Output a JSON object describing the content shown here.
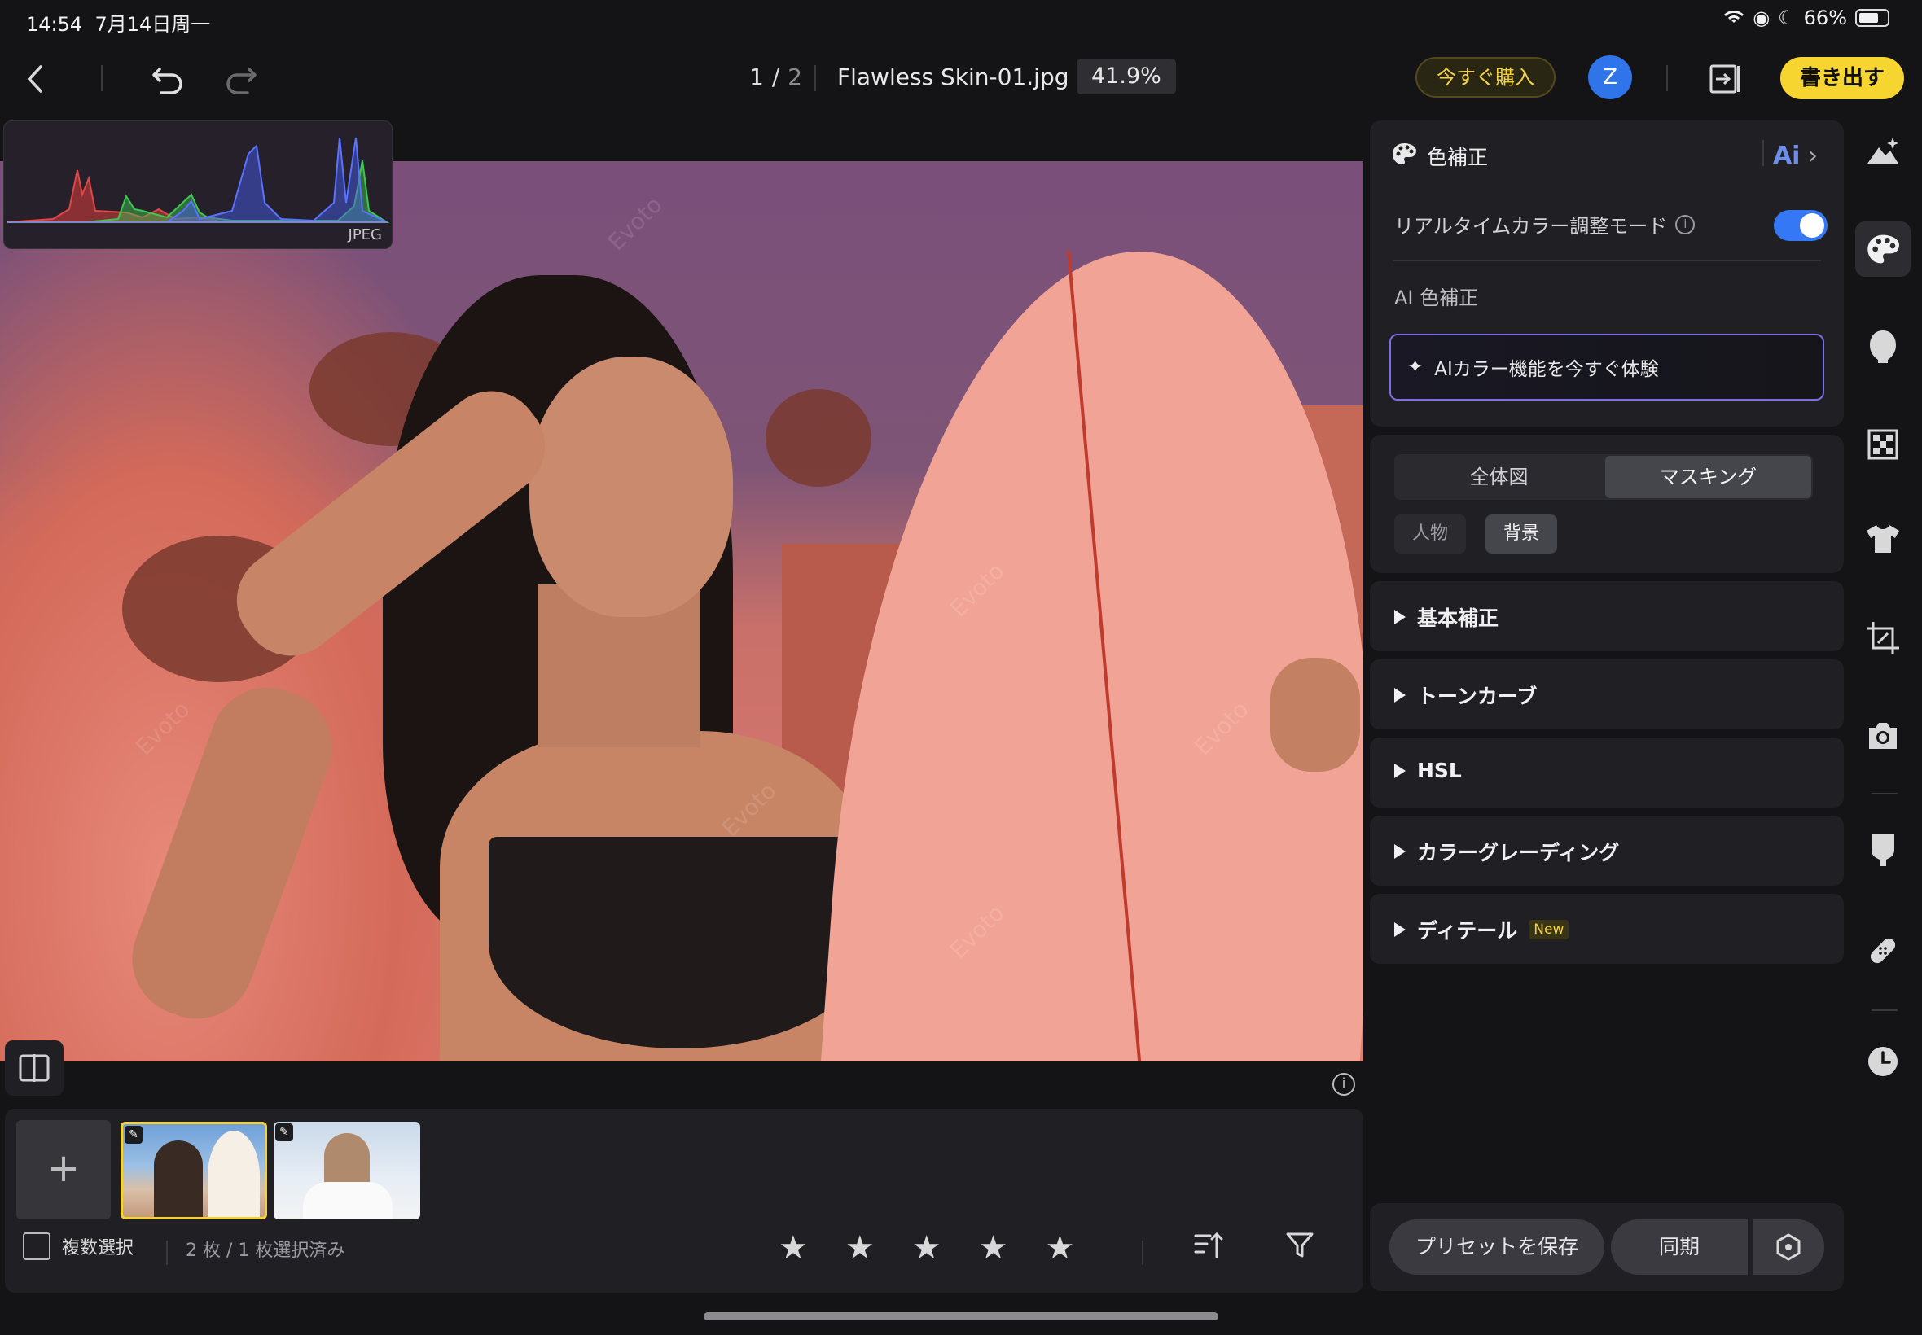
{
  "status_bar": {
    "time": "14:54",
    "date": "7月14日周一",
    "battery": "66%"
  },
  "topbar": {
    "page_current": "1",
    "page_sep": "/",
    "page_total": "2",
    "filename": "Flawless Skin-01.jpg",
    "zoom": "41.9%",
    "buy_label": "今すぐ購入",
    "avatar_letter": "Z",
    "export_label": "書き出す"
  },
  "histogram": {
    "label": "JPEG"
  },
  "filmstrip": {
    "add_label": "+",
    "multi_select_label": "複数選択",
    "count_label": "2 枚 / 1 枚選択済み",
    "rating_stars": 5
  },
  "panel": {
    "color_title": "色補正",
    "ai_badge": "Ai",
    "realtime_label": "リアルタイムカラー調整モード",
    "realtime_on": true,
    "ai_section_label": "AI 色補正",
    "ai_button_label": "AIカラー機能を今すぐ体験",
    "tabs": [
      {
        "label": "全体図",
        "active": false
      },
      {
        "label": "マスキング",
        "active": true
      }
    ],
    "chips": [
      {
        "label": "人物",
        "active": false
      },
      {
        "label": "背景",
        "active": true
      }
    ],
    "sections": [
      {
        "label": "基本補正"
      },
      {
        "label": "トーンカーブ"
      },
      {
        "label": "HSL"
      },
      {
        "label": "カラーグレーディング"
      },
      {
        "label": "ディテール",
        "badge": "New"
      }
    ],
    "save_preset_label": "プリセットを保存",
    "sync_label": "同期"
  },
  "watermark": "Evoto",
  "colors": {
    "accent_yellow": "#f7d531",
    "toggle_blue": "#3478f6",
    "avatar_blue": "#2f74e8"
  }
}
